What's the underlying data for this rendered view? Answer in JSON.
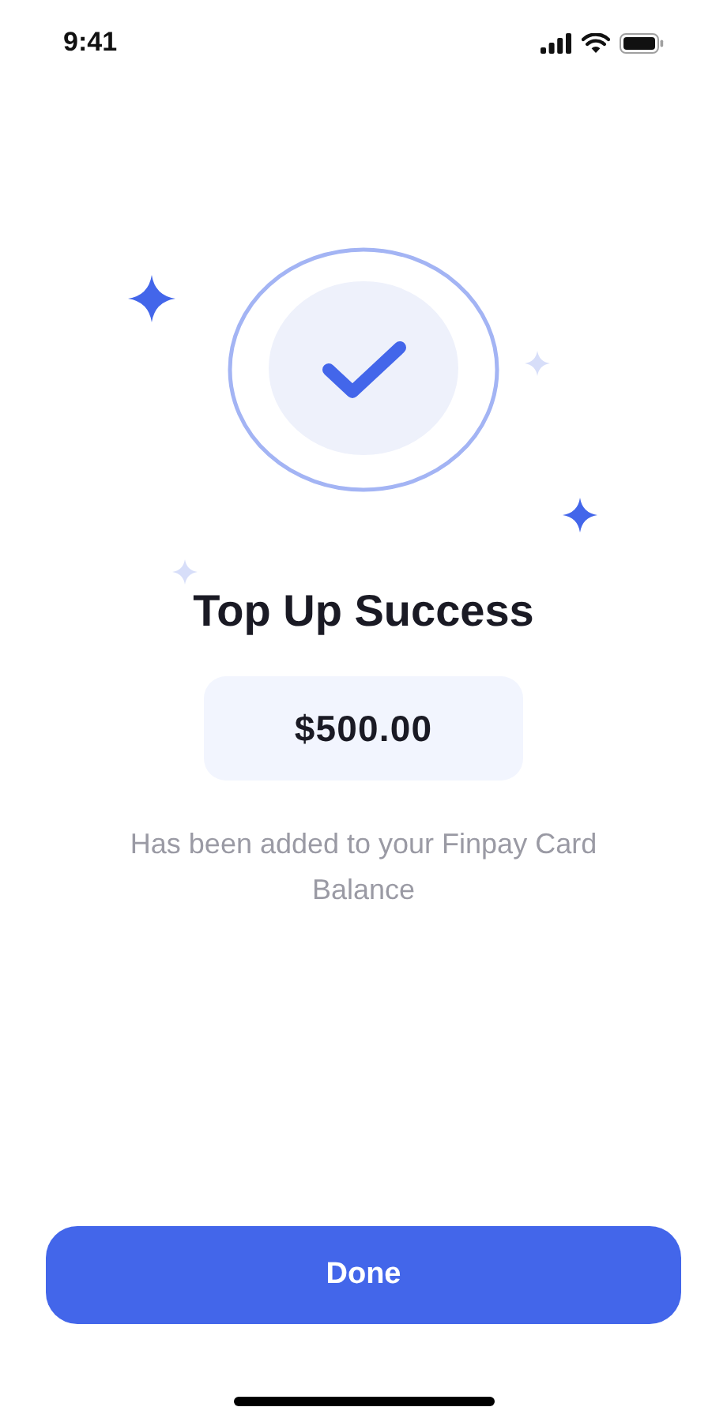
{
  "status_bar": {
    "time": "9:41"
  },
  "title": "Top Up Success",
  "amount": "$500.00",
  "message": "Has been added to your Finpay Card Balance",
  "button": {
    "label": "Done"
  }
}
